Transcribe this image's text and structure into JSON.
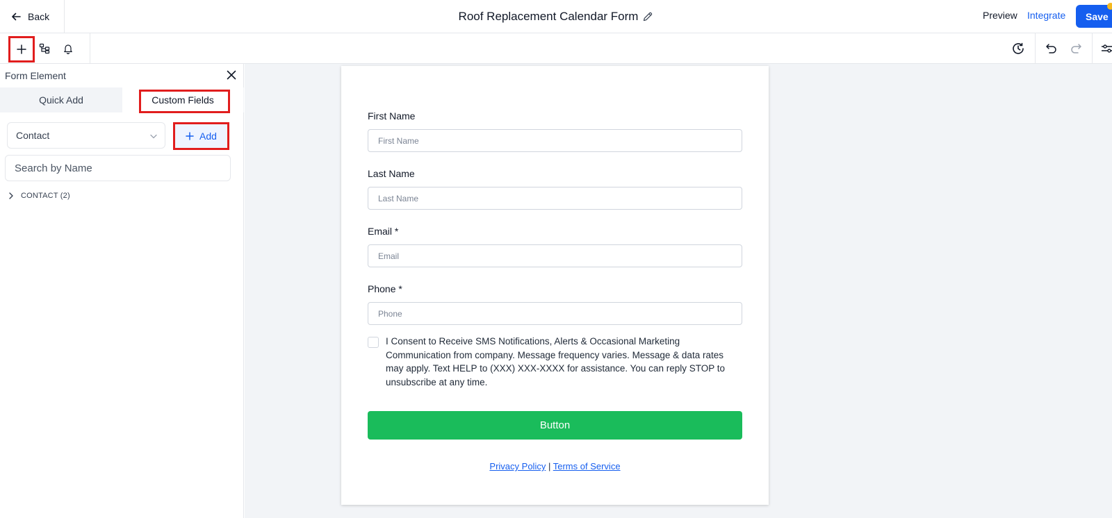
{
  "header": {
    "back_label": "Back",
    "form_title": "Roof Replacement Calendar Form",
    "preview_label": "Preview",
    "integrate_label": "Integrate",
    "save_label": "Save"
  },
  "toolbar": {
    "left_icons": [
      "plus-icon",
      "layers-icon",
      "bell-icon"
    ],
    "right_icons": [
      "history-icon",
      "undo-icon",
      "redo-icon",
      "sliders-icon"
    ]
  },
  "panel": {
    "title": "Form Element",
    "tabs": [
      {
        "label": "Quick Add",
        "active": false
      },
      {
        "label": "Custom Fields",
        "active": true
      }
    ],
    "object_select": "Contact",
    "add_label": "Add",
    "search_placeholder": "Search by Name",
    "groups": [
      {
        "label": "CONTACT (2)"
      }
    ]
  },
  "form": {
    "fields": [
      {
        "label": "First Name",
        "placeholder": "First Name"
      },
      {
        "label": "Last Name",
        "placeholder": "Last Name"
      },
      {
        "label": "Email *",
        "placeholder": "Email"
      },
      {
        "label": "Phone *",
        "placeholder": "Phone"
      }
    ],
    "consent_lines": [
      "I Consent to Receive SMS Notifications, Alerts & Occasional Marketing",
      "Communication from company. Message frequency varies. Message & data rates",
      "may apply. Text HELP to (XXX) XXX-XXXX for assistance. You can reply STOP to",
      "unsubscribe at any time."
    ],
    "button_label": "Button",
    "privacy_label": "Privacy Policy",
    "separator": "|",
    "terms_label": "Terms of Service"
  },
  "colors": {
    "primary": "#155eef",
    "submit": "#1abc5b",
    "highlight": "#e11d1d",
    "canvas_bg": "#f2f4f7"
  }
}
